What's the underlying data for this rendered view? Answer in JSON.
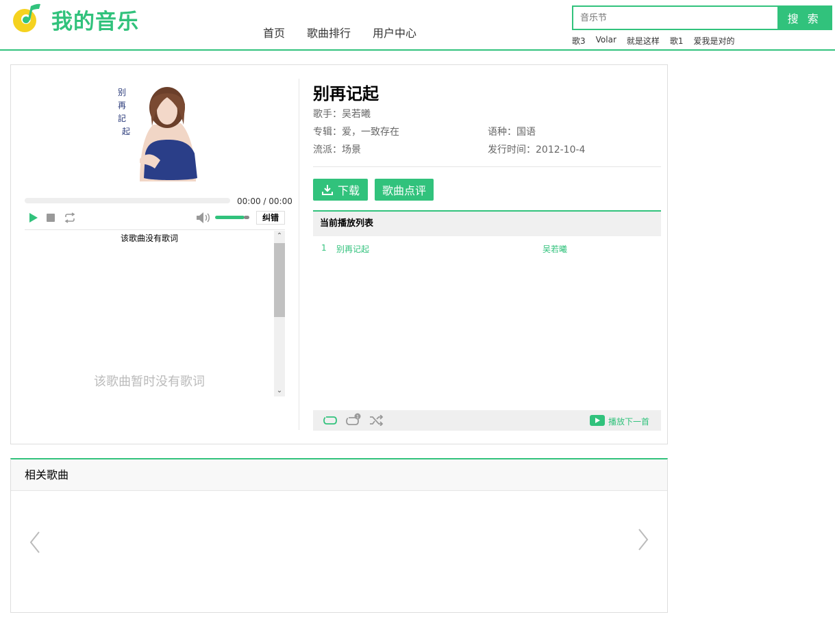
{
  "header": {
    "logo_text": "我的音乐",
    "nav": [
      "首页",
      "歌曲排行",
      "用户中心"
    ],
    "search_placeholder": "音乐节",
    "search_button": "搜 索",
    "hot_searches": [
      "歌3",
      "Volar",
      "就是这样",
      "歌1",
      "爱我是对的"
    ]
  },
  "player": {
    "cover_text": [
      "别",
      "再",
      "記",
      "起"
    ],
    "time": "00:00 / 00:00",
    "volume_fraction": 0.85,
    "fix_button": "纠错",
    "lyric_header": "该歌曲没有歌词",
    "lyric_empty": "该歌曲暂时没有歌词"
  },
  "song": {
    "title": "别再记起",
    "singer_label": "歌手：",
    "singer": "吴若曦",
    "album_label": "专辑：",
    "album": "爱，一致存在",
    "language_label": "语种：",
    "language": "国语",
    "genre_label": "流派：",
    "genre": "场景",
    "release_label": "发行时间：",
    "release": "2012-10-4",
    "download_button": "下载",
    "comment_button": "歌曲点评"
  },
  "playlist": {
    "title": "当前播放列表",
    "rows": [
      {
        "index": "1",
        "name": "别再记起",
        "singer": "吴若曦"
      }
    ],
    "next_label": "播放下一首"
  },
  "related": {
    "title": "相关歌曲"
  },
  "colors": {
    "accent": "#31c27c",
    "logo_yellow": "#f5d21f"
  }
}
